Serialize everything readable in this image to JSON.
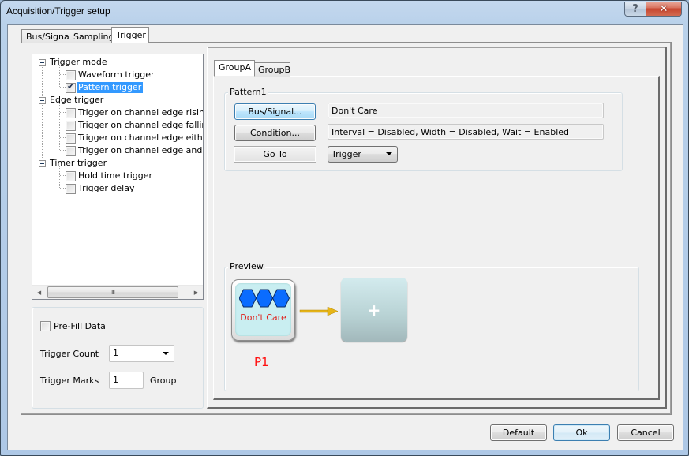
{
  "window": {
    "title": "Acquisition/Trigger setup",
    "help_label": "?",
    "close_label": "✕"
  },
  "outer_tabs": [
    {
      "label": "Bus/Signal",
      "selected": false
    },
    {
      "label": "Sampling",
      "selected": false
    },
    {
      "label": "Trigger",
      "selected": true
    }
  ],
  "tree": {
    "groups": [
      {
        "label": "Trigger mode",
        "items": [
          {
            "label": "Waveform trigger",
            "checked": false,
            "selected": false
          },
          {
            "label": "Pattern trigger",
            "checked": true,
            "selected": true
          }
        ]
      },
      {
        "label": "Edge trigger",
        "items": [
          {
            "label": "Trigger on channel edge rising",
            "checked": false,
            "selected": false
          },
          {
            "label": "Trigger on channel edge falling",
            "checked": false,
            "selected": false
          },
          {
            "label": "Trigger on channel edge either",
            "checked": false,
            "selected": false
          },
          {
            "label": "Trigger on channel edge and patt",
            "checked": false,
            "selected": false
          }
        ]
      },
      {
        "label": "Timer trigger",
        "items": [
          {
            "label": "Hold time trigger",
            "checked": false,
            "selected": false
          },
          {
            "label": "Trigger delay",
            "checked": false,
            "selected": false
          }
        ]
      }
    ],
    "scroll_thumb_glyph": "III"
  },
  "options": {
    "prefill_label": "Pre-Fill Data",
    "prefill_checked": false,
    "trigger_count_label": "Trigger Count",
    "trigger_count_value": "1",
    "trigger_marks_label": "Trigger Marks",
    "trigger_marks_value": "1",
    "trigger_marks_unit": "Group"
  },
  "inner_tabs": [
    {
      "label": "GroupA",
      "selected": true
    },
    {
      "label": "GroupB",
      "selected": false
    }
  ],
  "pattern": {
    "title": "Pattern1",
    "bus_signal_button": "Bus/Signal...",
    "bus_signal_value": "Don't Care",
    "condition_button": "Condition...",
    "condition_value": "Interval = Disabled, Width = Disabled, Wait = Enabled",
    "goto_button": "Go To",
    "goto_value": "Trigger"
  },
  "preview": {
    "title": "Preview",
    "node_text": "Don't Care",
    "node_label": "P1",
    "add_label": "+",
    "colors": {
      "hexagon": "#0a6cff",
      "node_text": "#e0201c",
      "arrow": "#e6b416"
    }
  },
  "footer": {
    "default_label": "Default",
    "ok_label": "Ok",
    "cancel_label": "Cancel"
  }
}
